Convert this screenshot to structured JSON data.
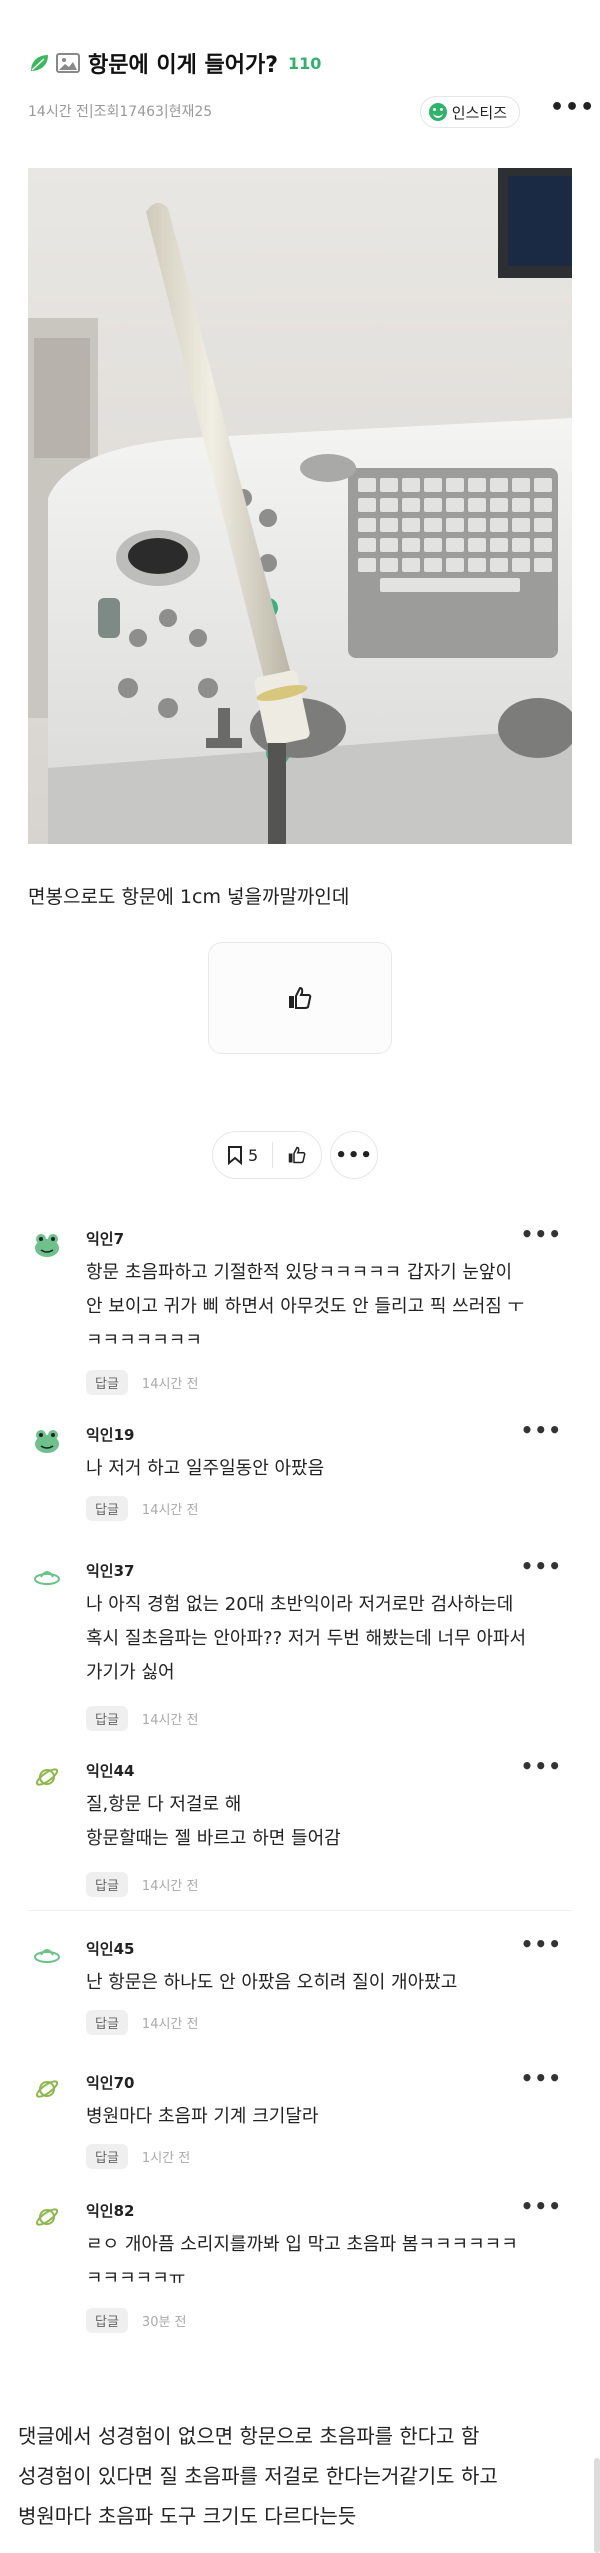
{
  "post": {
    "title": "항문에 이게 들어가?",
    "comment_count": "110",
    "time": "14시간 전",
    "views": "조회17463",
    "current": "현재25",
    "board_chip": "인스티즈",
    "body": "면봉으로도 항문에 1cm 넣을까말까인데",
    "bookmark_count": "5"
  },
  "comments": [
    {
      "name": "익인7",
      "text": "항문 초음파하고 기절한적 있당ㅋㅋㅋㅋㅋ 갑자기 눈앞이\n안 보이고 귀가 삐 하면서 아무것도 안 들리고 픽 쓰러짐 ㅜ\nㅋㅋㅋㅋㅋㅋㅋ",
      "reply": "답글",
      "time": "14시간 전"
    },
    {
      "name": "익인19",
      "text": "나 저거 하고 일주일동안 아팠음",
      "reply": "답글",
      "time": "14시간 전"
    },
    {
      "name": "익인37",
      "text": "나 아직 경험 없는 20대 초반익이라 저거로만 검사하는데\n혹시 질초음파는 안아파?? 저거 두번 해봤는데 너무 아파서\n가기가 싫어",
      "reply": "답글",
      "time": "14시간 전"
    },
    {
      "name": "익인44",
      "text": "질,항문 다 저걸로 해\n항문할때는 젤 바르고 하면 들어감",
      "reply": "답글",
      "time": "14시간 전"
    },
    {
      "name": "익인45",
      "text": "난 항문은 하나도 안 아팠음 오히려 질이 개아팠고",
      "reply": "답글",
      "time": "14시간 전"
    },
    {
      "name": "익인70",
      "text": "병원마다 초음파 기계 크기달라",
      "reply": "답글",
      "time": "1시간 전"
    },
    {
      "name": "익인82",
      "text": "ㄹㅇ 개아픔 소리지를까봐 입 막고 초음파 봄ㅋㅋㅋㅋㅋㅋ\nㅋㅋㅋㅋㅋㅠ",
      "reply": "답글",
      "time": "30분 전"
    }
  ],
  "bottom_note": "댓글에서 성경험이 없으면 항문으로 초음파를 한다고 함\n성경험이 있다면 질 초음파를 저걸로 한다는거같기도 하고\n병원마다 초음파 도구 크기도 다르다는듯",
  "colors": {
    "accent": "#2eb36a",
    "avatar_green": "#6cc28a",
    "avatar_olive": "#8fb84a"
  }
}
